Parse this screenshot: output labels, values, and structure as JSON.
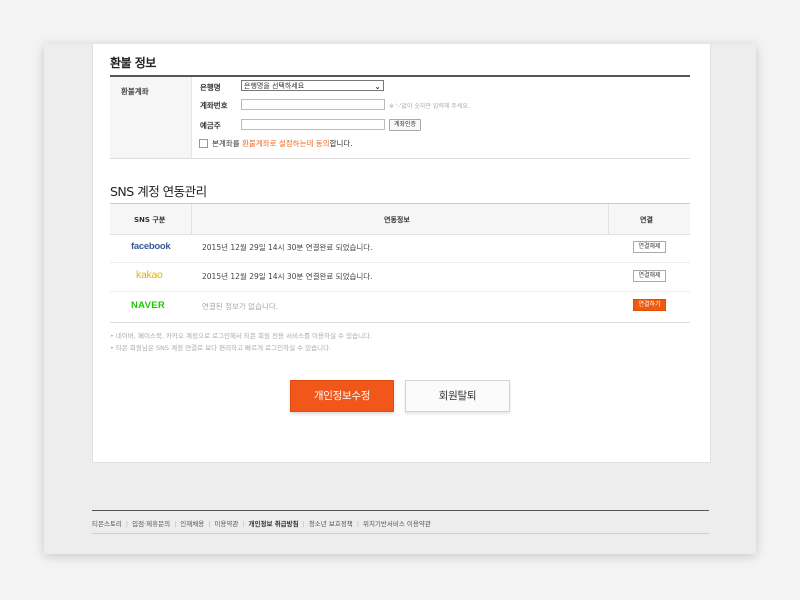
{
  "refund": {
    "title": "환불 정보",
    "account_label": "환불계좌",
    "bank_label": "은행명",
    "bank_select_value": "은행명을 선택하세요",
    "account_number_label": "계좌번호",
    "account_number_value": "",
    "account_hint": "※ '-'없이 숫자만 입력해 주세요.",
    "holder_label": "예금주",
    "holder_value": "",
    "verify_button": "계좌인증",
    "agree_prefix": "본계좌를 ",
    "agree_highlight": "환불계좌로 설정하는데 동의",
    "agree_suffix": "합니다."
  },
  "sns": {
    "title": "SNS 계정 연동관리",
    "headers": {
      "type": "SNS 구분",
      "info": "연동정보",
      "link": "연결"
    },
    "rows": [
      {
        "brand": "facebook",
        "info": "2015년 12월 29일 14시 30분 연결완료 되었습니다.",
        "button": "연결해제",
        "active": false
      },
      {
        "brand": "kakao",
        "info": "2015년 12월 29일 14시 30분 연결완료 되었습니다.",
        "button": "연결해제",
        "active": false
      },
      {
        "brand": "NAVER",
        "info": "연결된 정보가 없습니다.",
        "button": "연결하기",
        "active": true
      }
    ],
    "notes": [
      "• 네이버, 페이스북, 카카오 계정으로 로그인해서 티몬 회원 전용 서비스를 이용하실 수 있습니다.",
      "• 티몬 회원님은 SNS 계정 연결로 보다 편리하고 빠르게 로그인하실 수 있습니다."
    ]
  },
  "actions": {
    "edit_button": "개인정보수정",
    "withdraw_button": "회원탈퇴"
  },
  "footer": {
    "links": [
      "티몬스토리",
      "입점·제휴문의",
      "인재채용",
      "이용약관",
      "개인정보 취급방침",
      "청소년 보호정책",
      "위치기반서비스 이용약관"
    ],
    "bold_index": 4
  },
  "colors": {
    "accent": "#f1561a",
    "highlight_text": "#f26a1b",
    "facebook": "#3b5998",
    "kakao": "#e8b400",
    "naver": "#1ec800"
  }
}
